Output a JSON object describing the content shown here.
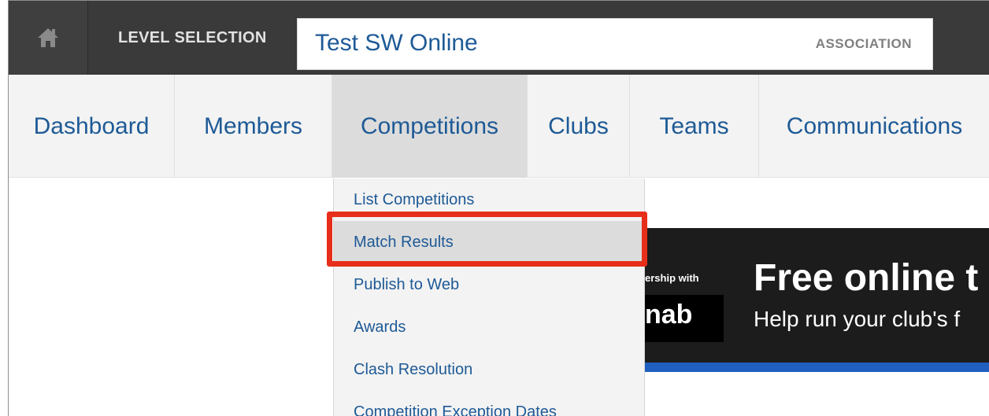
{
  "topbar": {
    "home_icon": "home-icon",
    "level_label": "LEVEL SELECTION",
    "org_name": "Test SW Online",
    "org_type": "ASSOCIATION"
  },
  "nav": {
    "items": [
      {
        "label": "Dashboard"
      },
      {
        "label": "Members"
      },
      {
        "label": "Competitions"
      },
      {
        "label": "Clubs"
      },
      {
        "label": "Teams"
      },
      {
        "label": "Communications"
      }
    ],
    "active": "Competitions"
  },
  "dropdown": {
    "items": [
      {
        "label": "List Competitions"
      },
      {
        "label": "Match Results"
      },
      {
        "label": "Publish to Web"
      },
      {
        "label": "Awards"
      },
      {
        "label": "Clash Resolution"
      },
      {
        "label": "Competition Exception Dates"
      }
    ],
    "highlighted": "Match Results"
  },
  "banner": {
    "partner_text": "ership with",
    "logo_text": "nab",
    "headline": "Free online t",
    "subline": "Help run your club's f"
  },
  "colors": {
    "link": "#1e5a96",
    "topbar": "#3a3a3a",
    "highlight": "#e62e1a",
    "banner_stripe": "#1f5fbf"
  }
}
